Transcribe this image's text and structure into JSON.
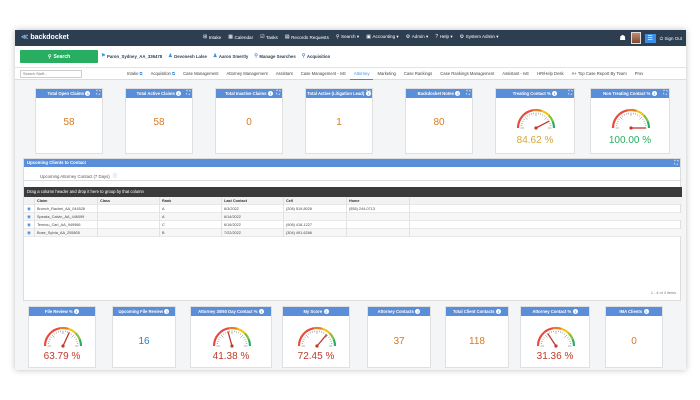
{
  "app": {
    "logo": "backdocket"
  },
  "topnav": [
    {
      "icon": "intake-icon",
      "glyph": "⊞",
      "label": "Intake"
    },
    {
      "icon": "calendar-icon",
      "glyph": "▦",
      "label": "Calendar"
    },
    {
      "icon": "tasks-icon",
      "glyph": "☑",
      "label": "Tasks"
    },
    {
      "icon": "records-icon",
      "glyph": "▤",
      "label": "Records Requests"
    },
    {
      "icon": "search-icon",
      "glyph": "⚲",
      "label": "Search ▾"
    },
    {
      "icon": "accounting-icon",
      "glyph": "▣",
      "label": "Accounting ▾"
    },
    {
      "icon": "admin-icon",
      "glyph": "⚙",
      "label": "Admin ▾"
    },
    {
      "icon": "help-icon",
      "glyph": "?",
      "label": "Help ▾"
    },
    {
      "icon": "system-admin-icon",
      "glyph": "⚙",
      "label": "System Admin ▾"
    }
  ],
  "topright": {
    "notif_count": "0",
    "signout": "Sign Out"
  },
  "search_button": "Search",
  "recent": [
    {
      "icon": "client-icon",
      "glyph": "⚑",
      "label": "Paron_Sydney_AA_336478"
    },
    {
      "icon": "user-icon",
      "glyph": "♟",
      "label": "Devonesh Lalse"
    },
    {
      "icon": "user-icon",
      "glyph": "♟",
      "label": "Aaron Smertly"
    },
    {
      "icon": "search-icon",
      "glyph": "⚲",
      "label": "Manage Searches"
    },
    {
      "icon": "search-icon",
      "glyph": "⚲",
      "label": "Acquisition"
    }
  ],
  "staff_search_placeholder": "Search Staff...",
  "tabs": [
    {
      "label": "Intake",
      "ext": true
    },
    {
      "label": "Acquisition",
      "ext": true
    },
    {
      "label": "Case Management",
      "ext": false
    },
    {
      "label": "Attorney Management",
      "ext": false
    },
    {
      "label": "Assistant",
      "ext": false
    },
    {
      "label": "Case Management - IvE",
      "ext": false
    },
    {
      "label": "Attorney",
      "ext": false,
      "active": true
    },
    {
      "label": "Marketing",
      "ext": false
    },
    {
      "label": "Case Rankings",
      "ext": false
    },
    {
      "label": "Case Rankings Management",
      "ext": false
    },
    {
      "label": "Assistant - IvE",
      "ext": false
    },
    {
      "label": "HR/Help Desk",
      "ext": false
    },
    {
      "label": "A+ Top Case Report By Team",
      "ext": false
    },
    {
      "label": "Prov",
      "ext": false
    }
  ],
  "top_widgets": [
    {
      "title": "Total Open Claims",
      "value": "58"
    },
    {
      "title": "Total Active Claims",
      "value": "58"
    },
    {
      "title": "Total Inactive Claims",
      "value": "0"
    },
    {
      "title": "Total Active (Litigation Lead)",
      "value": "1"
    },
    {
      "title": "Backdocket Notes",
      "value": "80"
    }
  ],
  "top_gauges": [
    {
      "title": "Treating Contact %",
      "value": "84.62 %",
      "pct": 0.8462,
      "color": "#d4a73a"
    },
    {
      "title": "Non Treating Contact %",
      "value": "100.00 %",
      "pct": 1.0,
      "color": "#27ae60"
    }
  ],
  "panel": {
    "title": "Upcoming Clients to Contact",
    "subtab": "Upcoming Attorney Contact (7 Days)",
    "group_hint": "Drag a column header and drop it here to group by that column",
    "columns": [
      "Claim",
      "Class",
      "Rank",
      "Last Contact",
      "Cell",
      "Home",
      ""
    ],
    "rows": [
      [
        "Brunch_Rachel_AA_044528",
        "",
        "A",
        "6/3/2022",
        "(208) 519-8026",
        "(555) 244-0713",
        ""
      ],
      [
        "Speaks_Calvin_AA_446099",
        "",
        "A",
        "6/14/2022",
        "",
        "",
        ""
      ],
      [
        "Tennou_Carl_AA_949966",
        "",
        "C",
        "6/16/2022",
        "(908) 418-1227",
        "",
        ""
      ],
      [
        "Bose_Sylvia_AA_255805",
        "",
        "B",
        "7/22/2022",
        "(304) 491-6266",
        "",
        ""
      ]
    ],
    "pager": "1 - 4 of 4 items"
  },
  "bottom_widgets": [
    {
      "kind": "gauge",
      "title": "File Review %",
      "value": "63.79 %",
      "pct": 0.6379,
      "color": "#c0392b"
    },
    {
      "kind": "num",
      "title": "Upcoming File Review",
      "value": "16",
      "color": "#2c7fc0"
    },
    {
      "kind": "gauge",
      "title": "Attorney 30/60 Day Contact %",
      "value": "41.38 %",
      "pct": 0.4138,
      "color": "#c0392b"
    },
    {
      "kind": "gauge",
      "title": "My Score",
      "value": "72.45 %",
      "pct": 0.7245,
      "color": "#c0392b"
    },
    {
      "kind": "num",
      "title": "Attorney Contacts",
      "value": "37",
      "color": "#d77b1f"
    },
    {
      "kind": "num",
      "title": "Total Client Contacts",
      "value": "118",
      "color": "#d77b1f"
    },
    {
      "kind": "gauge",
      "title": "Attorney Contact %",
      "value": "31.36 %",
      "pct": 0.3136,
      "color": "#c0392b"
    },
    {
      "kind": "num",
      "title": "IMA Clients",
      "value": "0",
      "color": "#d77b1f"
    }
  ]
}
